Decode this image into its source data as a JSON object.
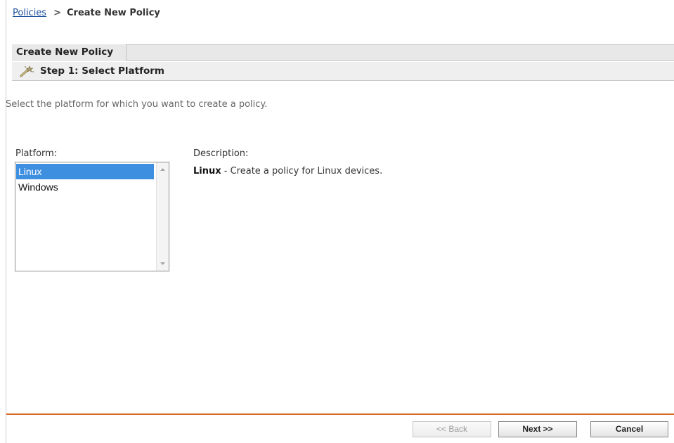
{
  "breadcrumb": {
    "parent_label": "Policies",
    "separator": ">",
    "current_label": "Create New Policy"
  },
  "tabs": [
    {
      "label": "Create New Policy",
      "active": true
    }
  ],
  "step": {
    "icon": "wand-icon",
    "title": "Step 1: Select Platform"
  },
  "intro_text": "Select the platform for which you want to create a policy.",
  "platform": {
    "label": "Platform:",
    "options": [
      {
        "label": "Linux",
        "selected": true
      },
      {
        "label": "Windows",
        "selected": false
      }
    ]
  },
  "description": {
    "label": "Description:",
    "name": "Linux",
    "text": " - Create a policy for Linux devices."
  },
  "buttons": {
    "back_label": "<< Back",
    "back_enabled": false,
    "next_label": "Next >>",
    "cancel_label": "Cancel"
  },
  "colors": {
    "link": "#1c4f9c",
    "selection": "#3f8fe0",
    "footer_rule": "#d96a2a"
  }
}
